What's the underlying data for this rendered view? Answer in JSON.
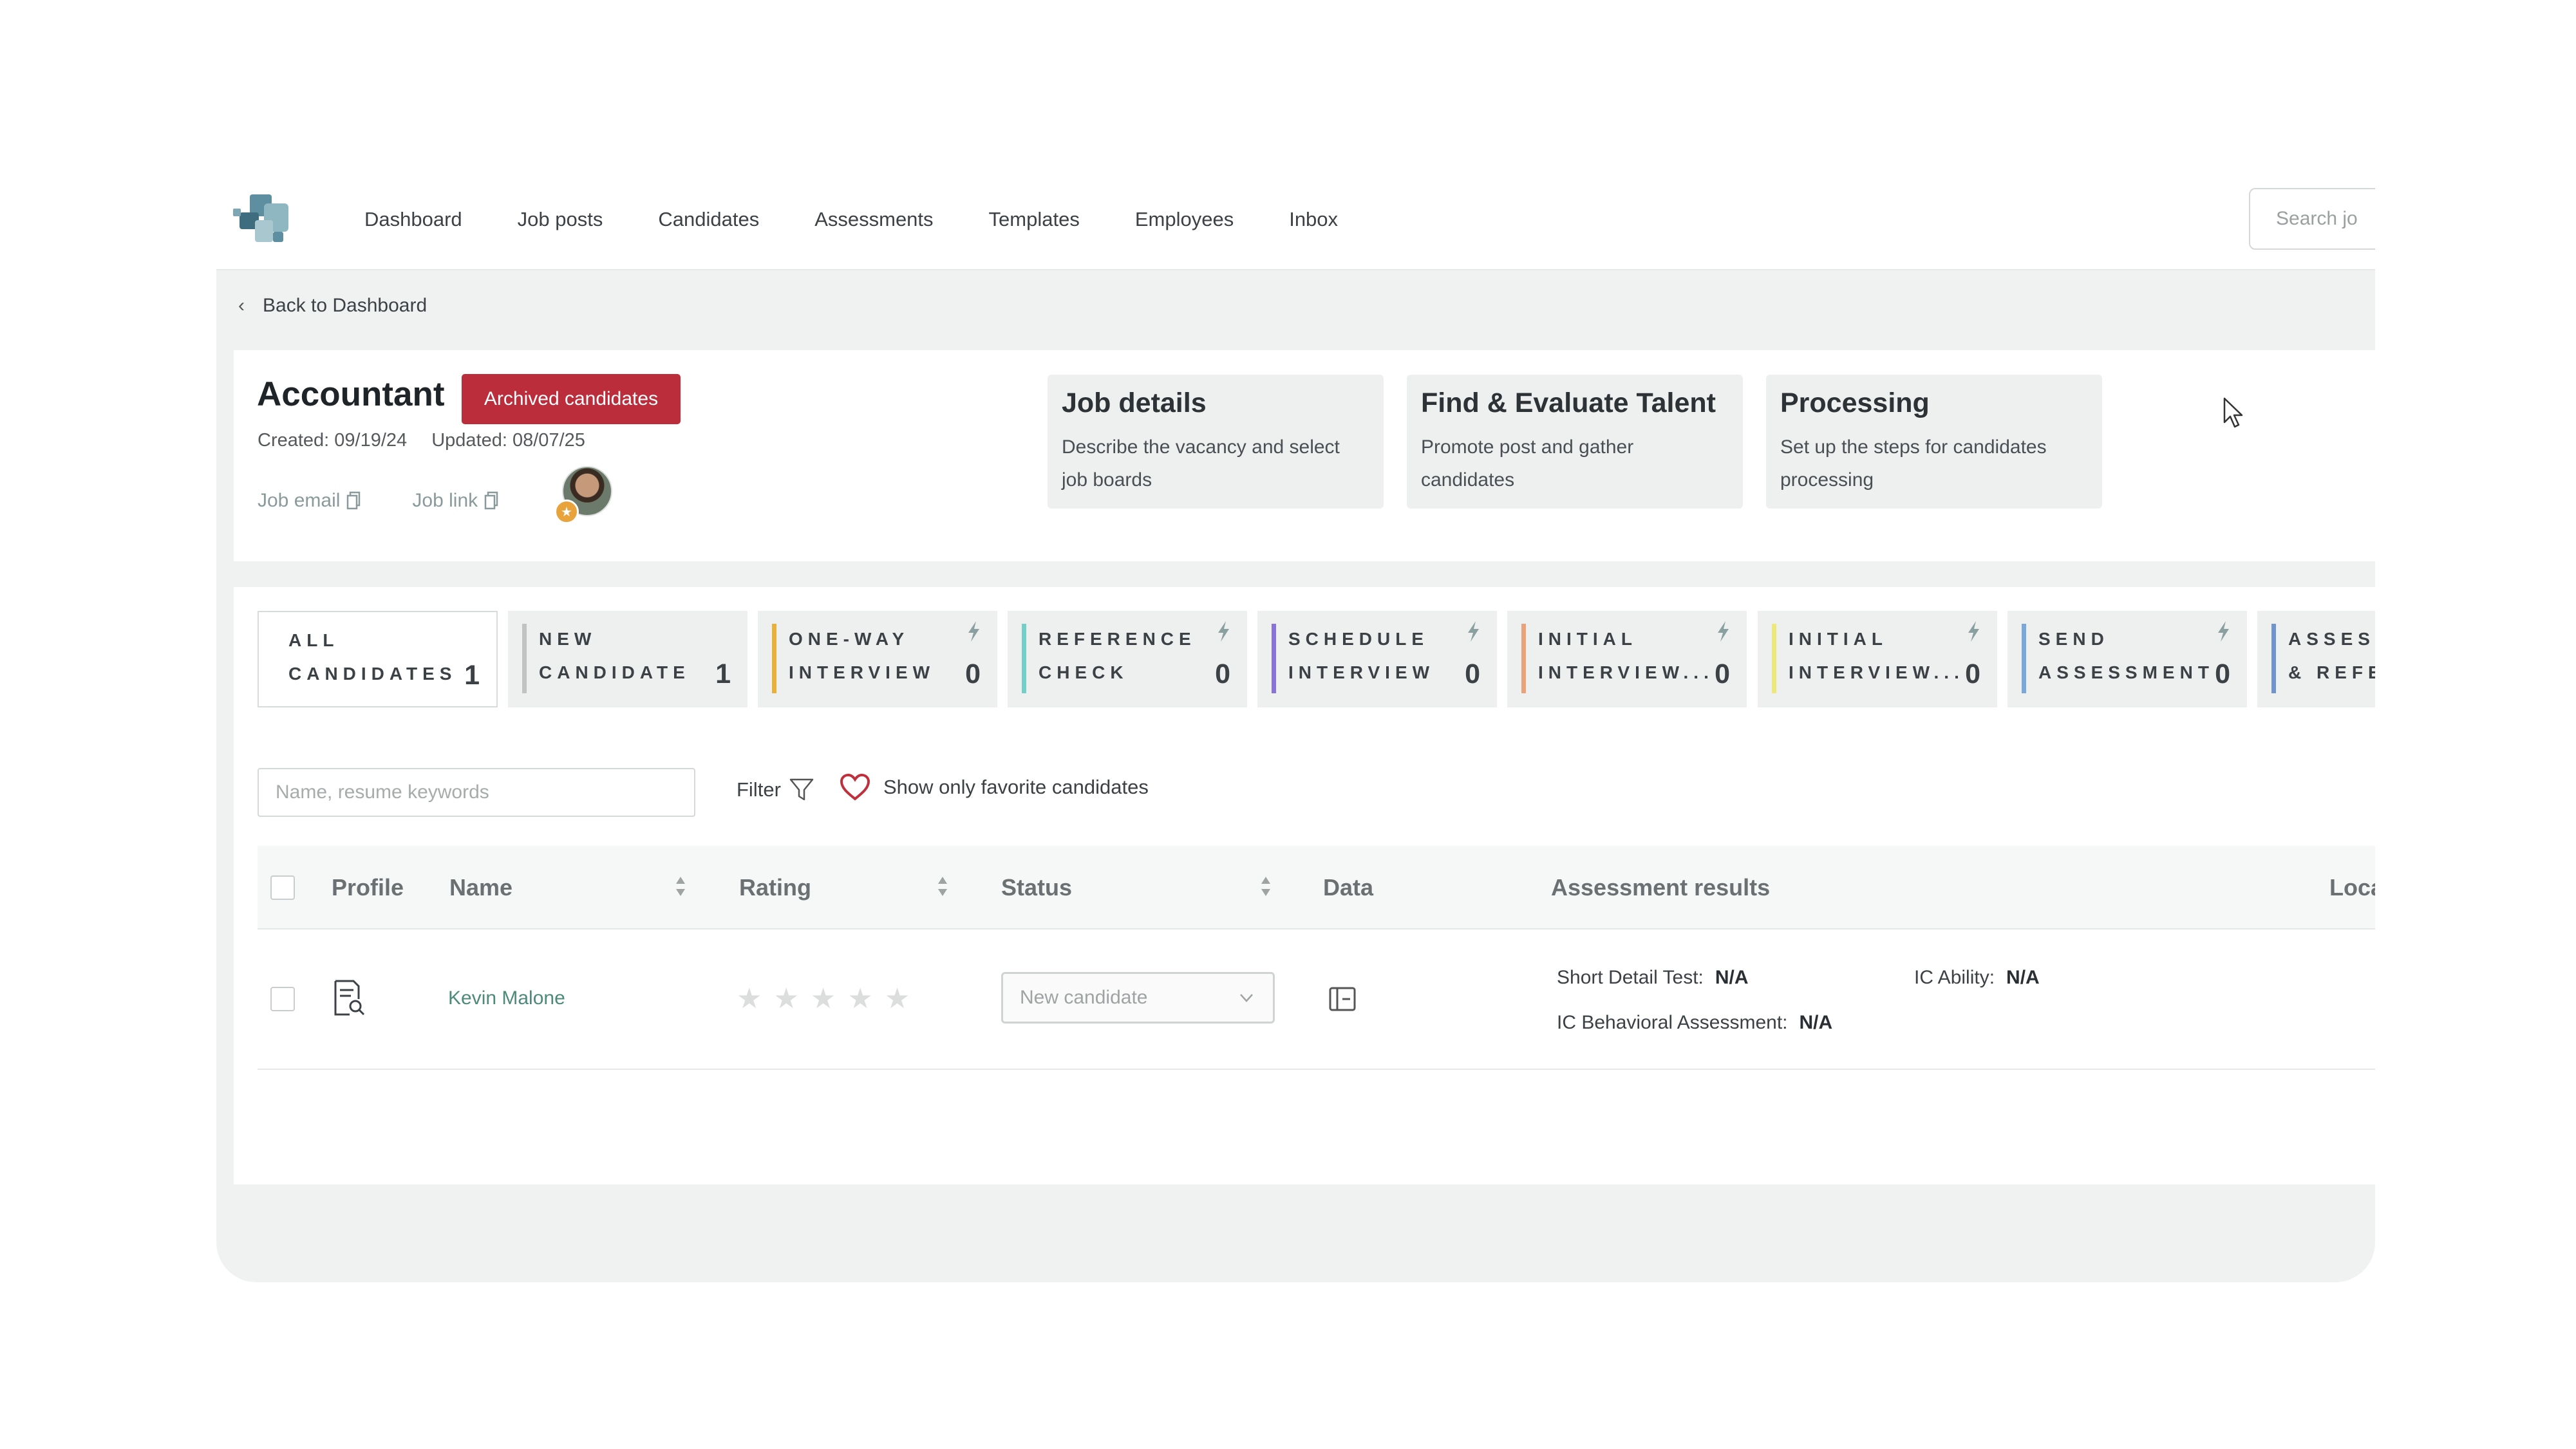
{
  "nav": {
    "items": [
      "Dashboard",
      "Job posts",
      "Candidates",
      "Assessments",
      "Templates",
      "Employees",
      "Inbox"
    ],
    "search_placeholder": "Search jo"
  },
  "back": {
    "label": "Back to Dashboard"
  },
  "job": {
    "title": "Accountant",
    "archived_label": "Archived candidates",
    "created": "Created: 09/19/24",
    "updated": "Updated: 08/07/25",
    "email_label": "Job email",
    "link_label": "Job link"
  },
  "steps": [
    {
      "title": "Job details",
      "desc_line1": "Describe the vacancy and select",
      "desc_line2": "job boards"
    },
    {
      "title": "Find & Evaluate Talent",
      "desc_line1": "Promote post and gather",
      "desc_line2": "candidates"
    },
    {
      "title": "Processing",
      "desc_line1": "Set up the steps for candidates",
      "desc_line2": "processing"
    }
  ],
  "stages": [
    {
      "label": "ALL\nCANDIDATES",
      "count": "1",
      "color": "",
      "automated": false,
      "active": true
    },
    {
      "label": "NEW\nCANDIDATE",
      "count": "1",
      "color": "#bfc3c3",
      "automated": false,
      "active": false
    },
    {
      "label": "ONE-WAY\nINTERVIEW",
      "count": "0",
      "color": "#e8b23a",
      "automated": true,
      "active": false
    },
    {
      "label": "REFERENCE\nCHECK",
      "count": "0",
      "color": "#74cfc8",
      "automated": true,
      "active": false
    },
    {
      "label": "SCHEDULE\nINTERVIEW",
      "count": "0",
      "color": "#8a73d8",
      "automated": true,
      "active": false
    },
    {
      "label": "INITIAL\nINTERVIEW...",
      "count": "0",
      "color": "#e9a27a",
      "automated": true,
      "active": false
    },
    {
      "label": "INITIAL\nINTERVIEW...",
      "count": "0",
      "color": "#ece87a",
      "automated": true,
      "active": false
    },
    {
      "label": "SEND\nASSESSMENT",
      "count": "0",
      "color": "#7aa8d8",
      "automated": true,
      "active": false
    },
    {
      "label": "ASSESSI\n& REFE...",
      "count": "",
      "color": "#6f95cc",
      "automated": false,
      "active": false
    }
  ],
  "filters": {
    "search_placeholder": "Name, resume keywords",
    "filter_label": "Filter",
    "favorites_label": "Show only favorite candidates"
  },
  "table": {
    "columns": {
      "profile": "Profile",
      "name": "Name",
      "rating": "Rating",
      "status": "Status",
      "data": "Data",
      "assessment": "Assessment results",
      "location": "Locati"
    },
    "rows": [
      {
        "name": "Kevin Malone",
        "rating": 0,
        "rating_max": 5,
        "status": "New candidate",
        "assessments": [
          {
            "label": "Short Detail Test:",
            "value": "N/A"
          },
          {
            "label": "IC Ability:",
            "value": "N/A"
          },
          {
            "label": "IC Behavioral Assessment:",
            "value": "N/A"
          }
        ]
      }
    ]
  }
}
